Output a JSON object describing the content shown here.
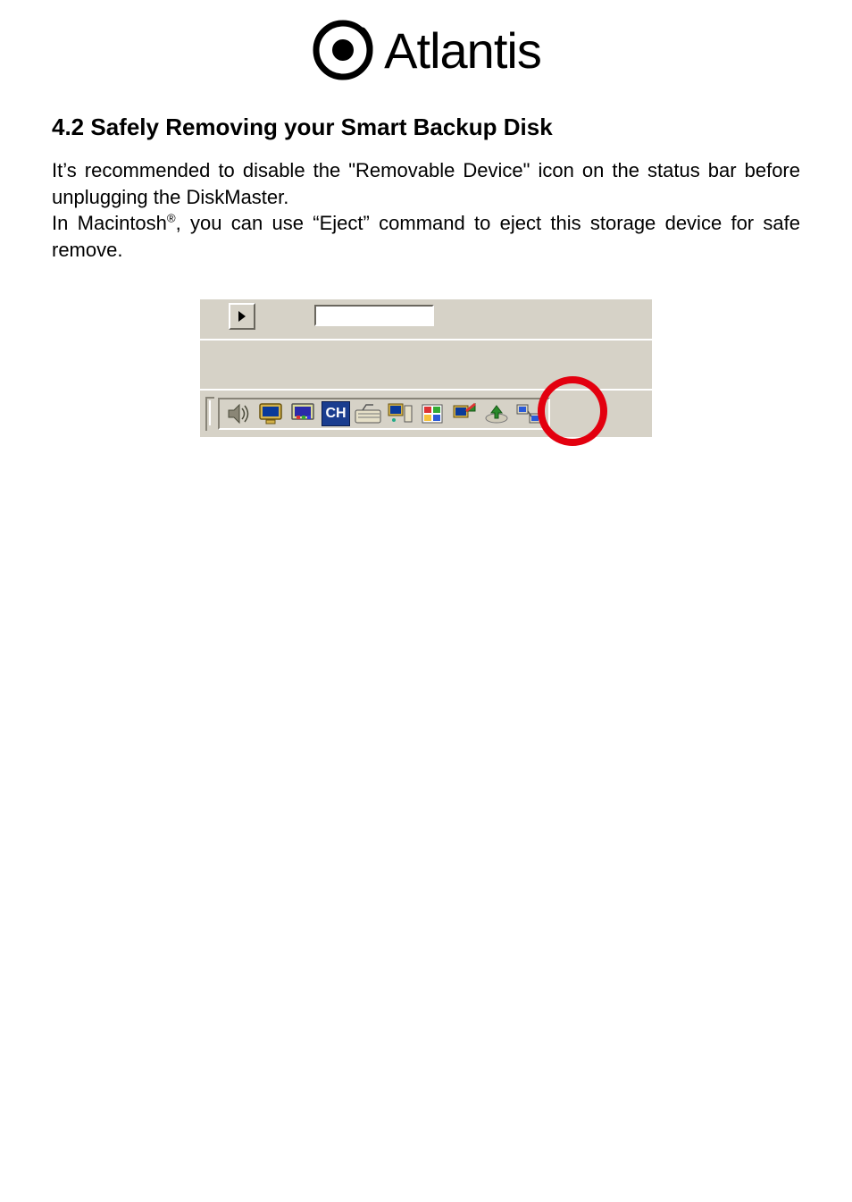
{
  "logo": {
    "text": "Atlantis"
  },
  "section": {
    "heading": "4.2 Safely Removing your Smart Backup Disk",
    "para1_a": "It’s recommended to disable the \"Removable Device\" icon on the status bar before unplugging the DiskMaster.",
    "para2_a": "In Macintosh",
    "para2_b": ", you can use “Eject” command to eject this storage device for safe remove."
  },
  "tray": {
    "ch_label": "CH"
  }
}
